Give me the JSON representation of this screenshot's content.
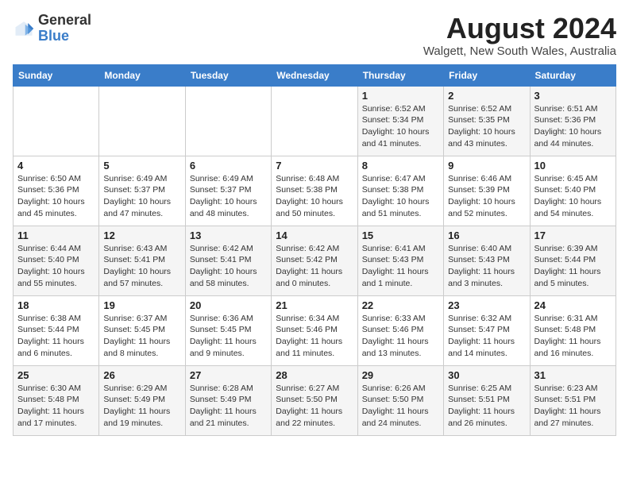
{
  "logo": {
    "line1": "General",
    "line2": "Blue"
  },
  "title": "August 2024",
  "subtitle": "Walgett, New South Wales, Australia",
  "days_of_week": [
    "Sunday",
    "Monday",
    "Tuesday",
    "Wednesday",
    "Thursday",
    "Friday",
    "Saturday"
  ],
  "weeks": [
    [
      {
        "day": "",
        "info": ""
      },
      {
        "day": "",
        "info": ""
      },
      {
        "day": "",
        "info": ""
      },
      {
        "day": "",
        "info": ""
      },
      {
        "day": "1",
        "info": "Sunrise: 6:52 AM\nSunset: 5:34 PM\nDaylight: 10 hours\nand 41 minutes."
      },
      {
        "day": "2",
        "info": "Sunrise: 6:52 AM\nSunset: 5:35 PM\nDaylight: 10 hours\nand 43 minutes."
      },
      {
        "day": "3",
        "info": "Sunrise: 6:51 AM\nSunset: 5:36 PM\nDaylight: 10 hours\nand 44 minutes."
      }
    ],
    [
      {
        "day": "4",
        "info": "Sunrise: 6:50 AM\nSunset: 5:36 PM\nDaylight: 10 hours\nand 45 minutes."
      },
      {
        "day": "5",
        "info": "Sunrise: 6:49 AM\nSunset: 5:37 PM\nDaylight: 10 hours\nand 47 minutes."
      },
      {
        "day": "6",
        "info": "Sunrise: 6:49 AM\nSunset: 5:37 PM\nDaylight: 10 hours\nand 48 minutes."
      },
      {
        "day": "7",
        "info": "Sunrise: 6:48 AM\nSunset: 5:38 PM\nDaylight: 10 hours\nand 50 minutes."
      },
      {
        "day": "8",
        "info": "Sunrise: 6:47 AM\nSunset: 5:38 PM\nDaylight: 10 hours\nand 51 minutes."
      },
      {
        "day": "9",
        "info": "Sunrise: 6:46 AM\nSunset: 5:39 PM\nDaylight: 10 hours\nand 52 minutes."
      },
      {
        "day": "10",
        "info": "Sunrise: 6:45 AM\nSunset: 5:40 PM\nDaylight: 10 hours\nand 54 minutes."
      }
    ],
    [
      {
        "day": "11",
        "info": "Sunrise: 6:44 AM\nSunset: 5:40 PM\nDaylight: 10 hours\nand 55 minutes."
      },
      {
        "day": "12",
        "info": "Sunrise: 6:43 AM\nSunset: 5:41 PM\nDaylight: 10 hours\nand 57 minutes."
      },
      {
        "day": "13",
        "info": "Sunrise: 6:42 AM\nSunset: 5:41 PM\nDaylight: 10 hours\nand 58 minutes."
      },
      {
        "day": "14",
        "info": "Sunrise: 6:42 AM\nSunset: 5:42 PM\nDaylight: 11 hours\nand 0 minutes."
      },
      {
        "day": "15",
        "info": "Sunrise: 6:41 AM\nSunset: 5:43 PM\nDaylight: 11 hours\nand 1 minute."
      },
      {
        "day": "16",
        "info": "Sunrise: 6:40 AM\nSunset: 5:43 PM\nDaylight: 11 hours\nand 3 minutes."
      },
      {
        "day": "17",
        "info": "Sunrise: 6:39 AM\nSunset: 5:44 PM\nDaylight: 11 hours\nand 5 minutes."
      }
    ],
    [
      {
        "day": "18",
        "info": "Sunrise: 6:38 AM\nSunset: 5:44 PM\nDaylight: 11 hours\nand 6 minutes."
      },
      {
        "day": "19",
        "info": "Sunrise: 6:37 AM\nSunset: 5:45 PM\nDaylight: 11 hours\nand 8 minutes."
      },
      {
        "day": "20",
        "info": "Sunrise: 6:36 AM\nSunset: 5:45 PM\nDaylight: 11 hours\nand 9 minutes."
      },
      {
        "day": "21",
        "info": "Sunrise: 6:34 AM\nSunset: 5:46 PM\nDaylight: 11 hours\nand 11 minutes."
      },
      {
        "day": "22",
        "info": "Sunrise: 6:33 AM\nSunset: 5:46 PM\nDaylight: 11 hours\nand 13 minutes."
      },
      {
        "day": "23",
        "info": "Sunrise: 6:32 AM\nSunset: 5:47 PM\nDaylight: 11 hours\nand 14 minutes."
      },
      {
        "day": "24",
        "info": "Sunrise: 6:31 AM\nSunset: 5:48 PM\nDaylight: 11 hours\nand 16 minutes."
      }
    ],
    [
      {
        "day": "25",
        "info": "Sunrise: 6:30 AM\nSunset: 5:48 PM\nDaylight: 11 hours\nand 17 minutes."
      },
      {
        "day": "26",
        "info": "Sunrise: 6:29 AM\nSunset: 5:49 PM\nDaylight: 11 hours\nand 19 minutes."
      },
      {
        "day": "27",
        "info": "Sunrise: 6:28 AM\nSunset: 5:49 PM\nDaylight: 11 hours\nand 21 minutes."
      },
      {
        "day": "28",
        "info": "Sunrise: 6:27 AM\nSunset: 5:50 PM\nDaylight: 11 hours\nand 22 minutes."
      },
      {
        "day": "29",
        "info": "Sunrise: 6:26 AM\nSunset: 5:50 PM\nDaylight: 11 hours\nand 24 minutes."
      },
      {
        "day": "30",
        "info": "Sunrise: 6:25 AM\nSunset: 5:51 PM\nDaylight: 11 hours\nand 26 minutes."
      },
      {
        "day": "31",
        "info": "Sunrise: 6:23 AM\nSunset: 5:51 PM\nDaylight: 11 hours\nand 27 minutes."
      }
    ]
  ]
}
